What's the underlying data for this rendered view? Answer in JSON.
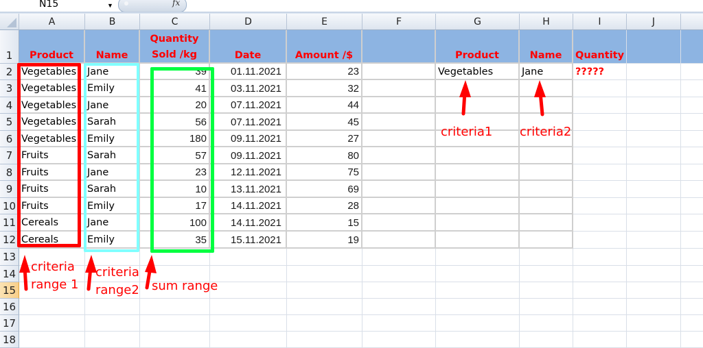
{
  "formula_bar": {
    "name_box": "N15",
    "fx_label": "fx",
    "formula": ""
  },
  "columns": [
    "A",
    "B",
    "C",
    "D",
    "E",
    "F",
    "G",
    "H",
    "I",
    "J"
  ],
  "rows": [
    "1",
    "2",
    "3",
    "4",
    "5",
    "6",
    "7",
    "8",
    "9",
    "10",
    "11",
    "12",
    "13",
    "14",
    "15",
    "16",
    "17",
    "18"
  ],
  "active_row": "15",
  "header_row": {
    "product": "Product",
    "name": "Name",
    "quantity_line1": "Quantity",
    "quantity_line2": "Sold /kg",
    "date": "Date",
    "amount": "Amount /$",
    "g_product": "Product",
    "h_name": "Name",
    "i_quantity": "Quantity"
  },
  "table": [
    {
      "product": "Vegetables",
      "name": "Jane",
      "qty": "39",
      "date": "01.11.2021",
      "amount": "23"
    },
    {
      "product": "Vegetables",
      "name": "Emily",
      "qty": "41",
      "date": "03.11.2021",
      "amount": "32"
    },
    {
      "product": "Vegetables",
      "name": "Jane",
      "qty": "20",
      "date": "07.11.2021",
      "amount": "44"
    },
    {
      "product": "Vegetables",
      "name": "Sarah",
      "qty": "56",
      "date": "07.11.2021",
      "amount": "45"
    },
    {
      "product": "Vegetables",
      "name": "Emily",
      "qty": "180",
      "date": "09.11.2021",
      "amount": "27"
    },
    {
      "product": "Fruits",
      "name": "Sarah",
      "qty": "57",
      "date": "09.11.2021",
      "amount": "80"
    },
    {
      "product": "Fruits",
      "name": "Jane",
      "qty": "23",
      "date": "12.11.2021",
      "amount": "75"
    },
    {
      "product": "Fruits",
      "name": "Sarah",
      "qty": "10",
      "date": "13.11.2021",
      "amount": "69"
    },
    {
      "product": "Fruits",
      "name": "Emily",
      "qty": "17",
      "date": "14.11.2021",
      "amount": "28"
    },
    {
      "product": "Cereals",
      "name": "Jane",
      "qty": "100",
      "date": "14.11.2021",
      "amount": "15"
    },
    {
      "product": "Cereals",
      "name": "Emily",
      "qty": "35",
      "date": "15.11.2021",
      "amount": "19"
    }
  ],
  "criteria": {
    "product": "Vegetables",
    "name": "Jane",
    "quantity_result": "?????"
  },
  "annotations": {
    "criteria_range1_line1": "criteria",
    "criteria_range1_line2": "range 1",
    "criteria_range2_line1": "criteria",
    "criteria_range2_line2": "range2",
    "sum_range": "sum range",
    "criteria1": "criteria1",
    "criteria2": "criteria2"
  },
  "colors": {
    "header_fill": "#8db4e2",
    "header_text": "#ff0000",
    "criteria_range1_box": "#ff0000",
    "criteria_range2_box": "#80ffff",
    "sum_range_box": "#00ff40",
    "annotation": "#ff0000",
    "active_row_header": "#f8cf8a"
  }
}
